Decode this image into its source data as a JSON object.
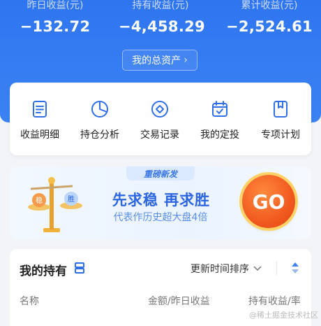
{
  "header": {
    "stats": [
      {
        "label": "昨日收益(元)",
        "value": "−132.72"
      },
      {
        "label": "持有收益(元)",
        "value": "−4,458.29"
      },
      {
        "label": "累计收益(元)",
        "value": "−2,524.61"
      }
    ],
    "assets_button": "我的总资产",
    "assets_chevron": "›"
  },
  "menu": [
    {
      "label": "收益明细",
      "icon": "document-list-icon"
    },
    {
      "label": "持仓分析",
      "icon": "pie-chart-icon"
    },
    {
      "label": "交易记录",
      "icon": "diamond-circle-icon"
    },
    {
      "label": "我的定投",
      "icon": "calendar-check-icon"
    },
    {
      "label": "专项计划",
      "icon": "bookmark-icon"
    }
  ],
  "banner": {
    "tag": "重磅新发",
    "title": "先求稳 再求胜",
    "subtitle": "代表作历史超大盘4倍",
    "scale_left": "稳",
    "scale_right": "胜",
    "go": "GO"
  },
  "holdings": {
    "title": "我的持有",
    "sort_label": "更新时间排序",
    "columns": [
      "名称",
      "金额/昨日收益",
      "持有收益/率"
    ]
  },
  "watermark": "@稀土掘金技术社区",
  "colors": {
    "primary": "#3b82f3",
    "accent_orange": "#f15a1f"
  }
}
